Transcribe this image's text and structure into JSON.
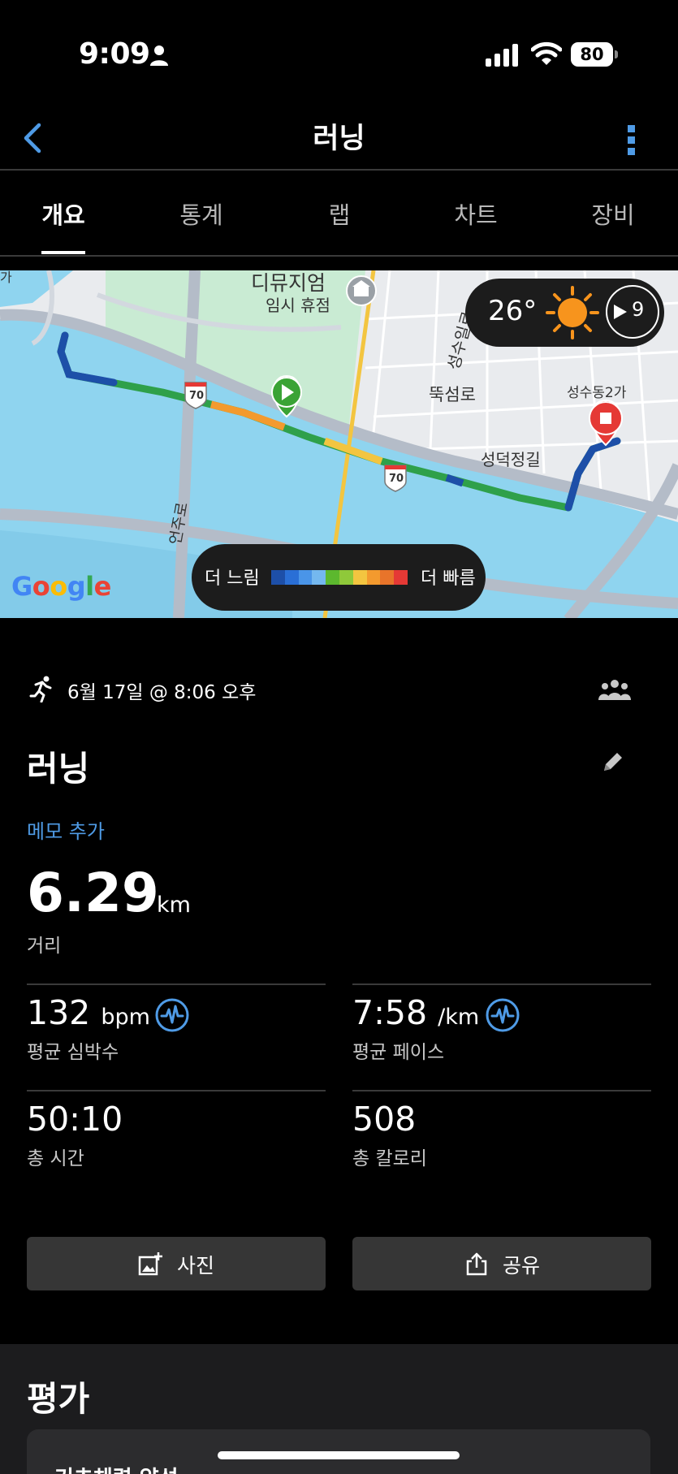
{
  "status_bar": {
    "time": "9:09",
    "battery": "80"
  },
  "header": {
    "title": "러닝"
  },
  "tabs": [
    {
      "label": "개요",
      "active": true
    },
    {
      "label": "통계",
      "active": false
    },
    {
      "label": "랩",
      "active": false
    },
    {
      "label": "차트",
      "active": false
    },
    {
      "label": "장비",
      "active": false
    }
  ],
  "map": {
    "labels": {
      "museum": "디뮤지엄",
      "closed": "임시 휴점",
      "road1": "뚝섬로",
      "road2": "성수일로",
      "road3": "성덕정길",
      "area": "성수동2가",
      "road4": "언주로",
      "hw1": "70",
      "hw2": "70",
      "edge": "가"
    },
    "weather": {
      "temperature": "26°",
      "wind": "9"
    },
    "legend": {
      "slow": "더 느림",
      "fast": "더 빠름",
      "colors": [
        "#1d4fa8",
        "#2a6fd6",
        "#4a95e8",
        "#74b8ef",
        "#5cb82e",
        "#8fc93a",
        "#f3c540",
        "#f39a2e",
        "#e8742a",
        "#e53935"
      ]
    },
    "attribution": "Google"
  },
  "activity": {
    "date": "6월 17일 @ 8:06 오후",
    "title": "러닝",
    "memo_link": "메모 추가",
    "distance": {
      "value": "6.29",
      "unit": "km",
      "label": "거리"
    },
    "stats": {
      "heart_rate": {
        "value": "132",
        "unit": "bpm",
        "label": "평균 심박수"
      },
      "pace": {
        "value": "7:58",
        "unit": "/km",
        "label": "평균 페이스"
      },
      "time": {
        "value": "50:10",
        "label": "총 시간"
      },
      "calories": {
        "value": "508",
        "label": "총 칼로리"
      }
    },
    "buttons": {
      "photo": "사진",
      "share": "공유"
    }
  },
  "evaluation": {
    "title": "평가",
    "card_text": "기초체력 양성"
  }
}
